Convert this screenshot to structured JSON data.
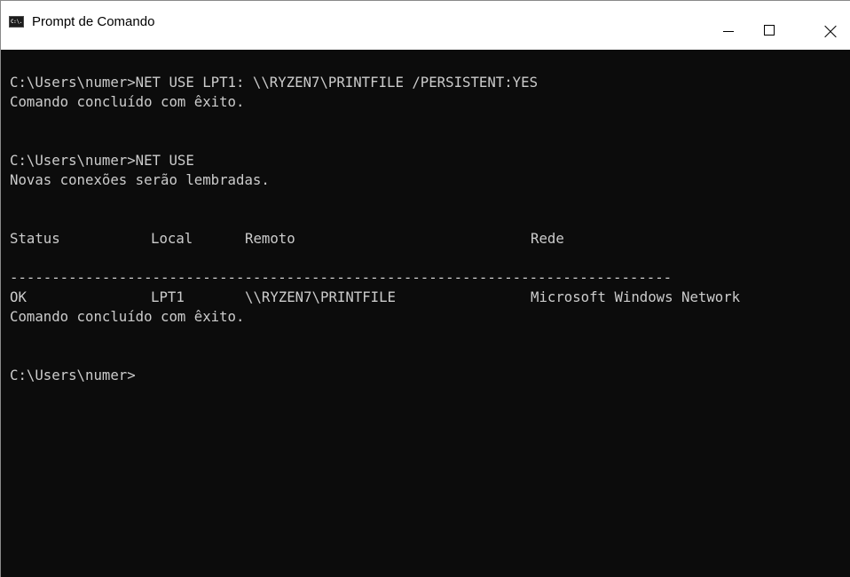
{
  "window": {
    "title": "Prompt de Comando",
    "icon_text": "C:\\.",
    "icon_name": "cmd-icon"
  },
  "console": {
    "lines": [
      "C:\\Users\\numer>NET USE LPT1: \\\\RYZEN7\\PRINTFILE /PERSISTENT:YES",
      "Comando concluído com êxito.",
      "",
      "",
      "C:\\Users\\numer>NET USE",
      "Novas conexões serão lembradas.",
      "",
      ""
    ],
    "table_headers": {
      "status": "Status",
      "local": "Local",
      "remote": "Remoto",
      "network": "Rede"
    },
    "separator": "-------------------------------------------------------------------------------",
    "table_row": {
      "status": "OK",
      "local": "LPT1",
      "remote": "\\\\RYZEN7\\PRINTFILE",
      "network": "Microsoft Windows Network"
    },
    "after_lines": [
      "Comando concluído com êxito.",
      "",
      "",
      "C:\\Users\\numer>"
    ]
  }
}
